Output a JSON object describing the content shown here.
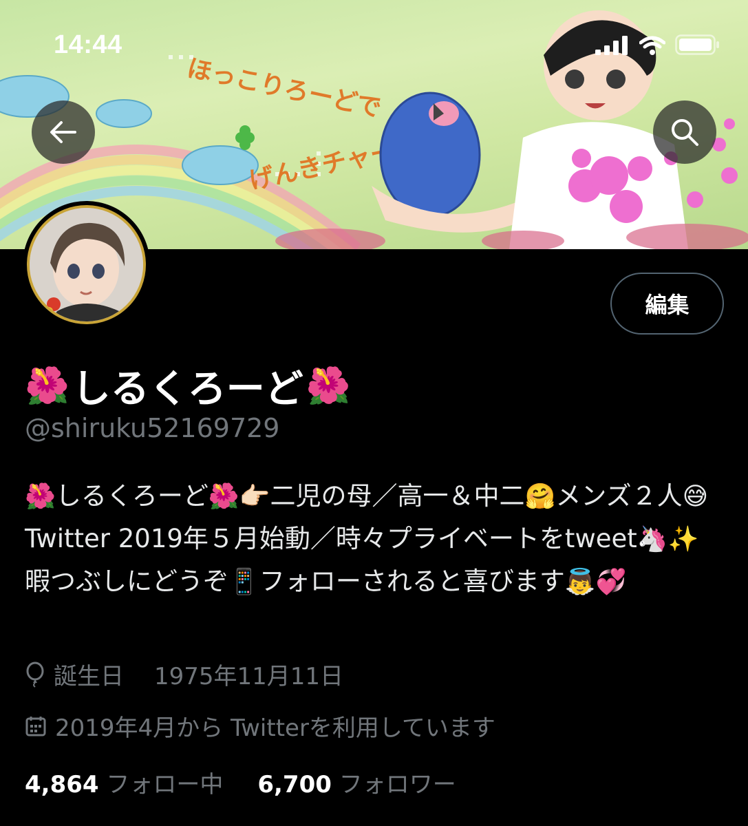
{
  "status_bar": {
    "time": "14:44"
  },
  "banner": {
    "text_line1": "ほっこりろーどで",
    "text_line2": "げんきチャージ"
  },
  "profile": {
    "display_name": "しるくろーど",
    "name_emoji": "🌺",
    "handle": "@shiruku52169729",
    "edit_label": "編集"
  },
  "bio": {
    "parts": [
      "しるくろーど",
      "二児の母／高一＆中二",
      "メンズ２人",
      "Twitter 2019年５月始動／時々プライベートをtweet",
      "暇つぶしにどうぞ",
      "フォローされると喜びます"
    ],
    "emojis": [
      "🌺",
      "🌺",
      "👉🏻",
      "🤗",
      "😅",
      "🦄",
      "✨",
      "📱",
      "👼",
      "💞"
    ]
  },
  "meta": {
    "birthday_label": "誕生日",
    "birthday_value": "1975年11月11日",
    "joined": "2019年4月から Twitterを利用しています"
  },
  "stats": {
    "following_count": "4,864",
    "following_label": "フォロー中",
    "followers_count": "6,700",
    "followers_label": "フォロワー"
  },
  "icons": {
    "back": "arrow-left-icon",
    "search": "search-icon",
    "birthday": "balloon-icon",
    "calendar": "calendar-icon"
  },
  "colors": {
    "background": "#000000",
    "secondary_text": "#71767b",
    "avatar_border": "#c9a437"
  }
}
